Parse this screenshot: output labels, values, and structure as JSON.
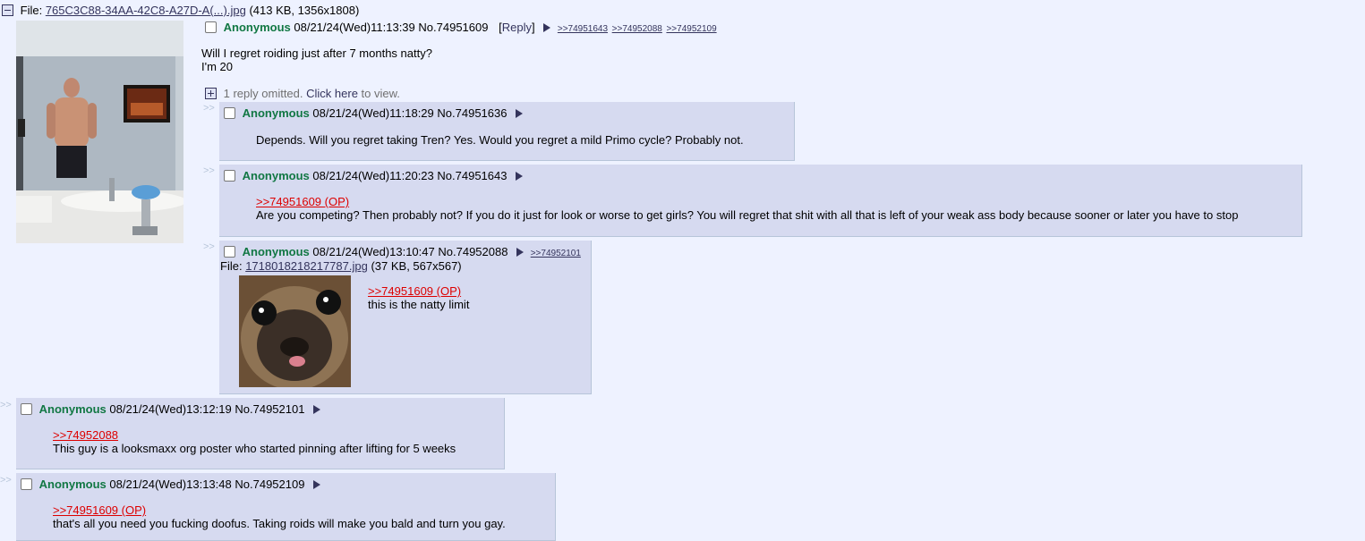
{
  "op": {
    "file_label": "File:",
    "file_name": "765C3C88-34AA-42C8-A27D-A(...).jpg",
    "file_info": "(413 KB, 1356x1808)",
    "name": "Anonymous",
    "datetime": "08/21/24(Wed)11:13:39",
    "post_no": "No.74951609",
    "reply_label": "[Reply]",
    "backlinks": [
      ">>74951643",
      ">>74952088",
      ">>74952109"
    ],
    "message_line1": "Will I regret roiding just after 7 months natty?",
    "message_line2": "I'm 20",
    "omitted_pre": "1 reply omitted.",
    "omitted_click": "Click here",
    "omitted_post": "to view."
  },
  "arrows": ">>",
  "replies": [
    {
      "name": "Anonymous",
      "datetime": "08/21/24(Wed)11:18:29",
      "post_no": "No.74951636",
      "text": "Depends. Will you regret taking Tren? Yes. Would you regret a mild Primo cycle? Probably not."
    },
    {
      "name": "Anonymous",
      "datetime": "08/21/24(Wed)11:20:23",
      "post_no": "No.74951643",
      "quote": ">>74951609 (OP)",
      "text": "Are you competing? Then probably not? If you do it just for look or worse to get girls? You will regret that shit with all that is left of your weak ass body because sooner or later you have to stop"
    },
    {
      "name": "Anonymous",
      "datetime": "08/21/24(Wed)13:10:47",
      "post_no": "No.74952088",
      "backlink": ">>74952101",
      "file_label": "File:",
      "file_name": "1718018218217787.jpg",
      "file_info": "(37 KB, 567x567)",
      "quote": ">>74951609 (OP)",
      "text": "this is the natty limit"
    },
    {
      "name": "Anonymous",
      "datetime": "08/21/24(Wed)13:12:19",
      "post_no": "No.74952101",
      "quote": ">>74952088",
      "text": "This guy is a looksmaxx org poster who started pinning after lifting for 5 weeks"
    },
    {
      "name": "Anonymous",
      "datetime": "08/21/24(Wed)13:13:48",
      "post_no": "No.74952109",
      "quote": ">>74951609 (OP)",
      "text": "that's all you need you fucking doofus. Taking roids will make you bald and turn you gay."
    }
  ]
}
